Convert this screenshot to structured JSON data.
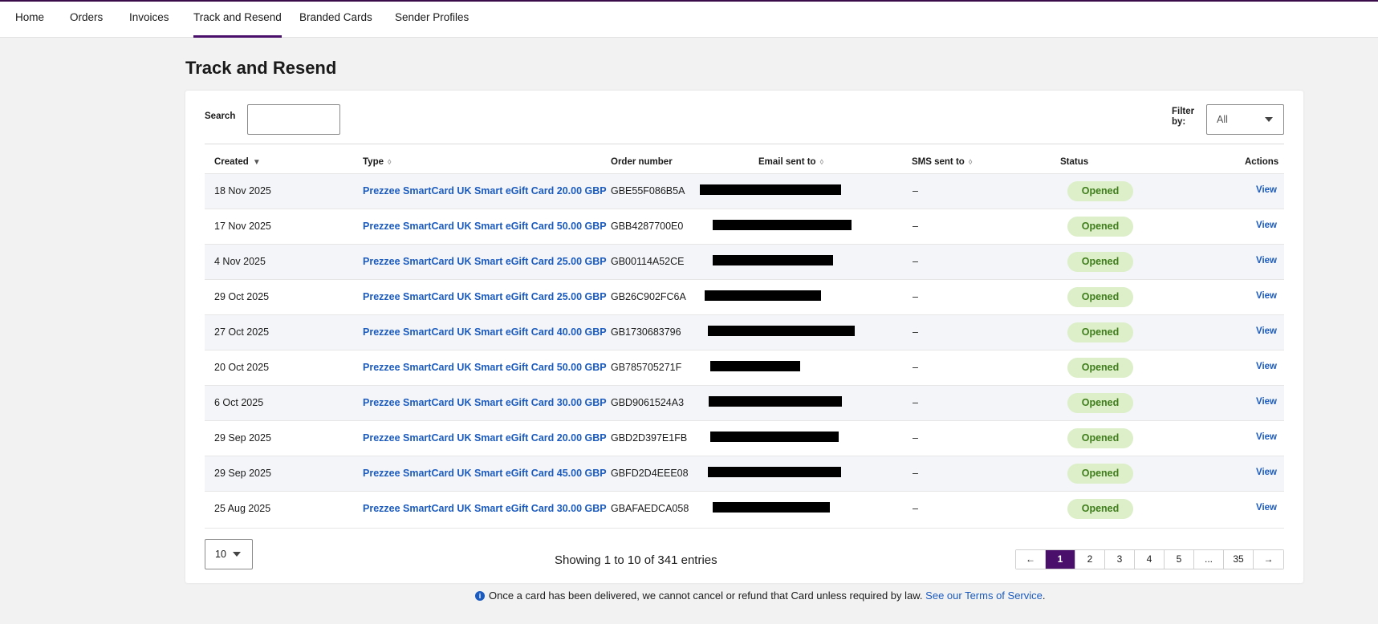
{
  "nav": {
    "items": [
      {
        "label": "Home"
      },
      {
        "label": "Orders"
      },
      {
        "label": "Invoices"
      },
      {
        "label": "Track and Resend"
      },
      {
        "label": "Branded Cards"
      },
      {
        "label": "Sender Profiles"
      }
    ],
    "active": "Track and Resend"
  },
  "page": {
    "title": "Track and Resend"
  },
  "search": {
    "label": "Search",
    "value": ""
  },
  "filter": {
    "label": "Filter by:",
    "value": "All"
  },
  "table": {
    "columns": [
      "Created",
      "Type",
      "Order number",
      "Email sent to",
      "SMS sent to",
      "Status",
      "Actions"
    ],
    "rows": [
      {
        "created": "18 Nov 2025",
        "type": "Prezzee SmartCard UK Smart eGift Card 20.00 GBP",
        "order": "GBE55F086B5A",
        "sms": "–",
        "status": "Opened",
        "action": "View"
      },
      {
        "created": "17 Nov 2025",
        "type": "Prezzee SmartCard UK Smart eGift Card 50.00 GBP",
        "order": "GBB4287700E0",
        "sms": "–",
        "status": "Opened",
        "action": "View"
      },
      {
        "created": "4 Nov 2025",
        "type": "Prezzee SmartCard UK Smart eGift Card 25.00 GBP",
        "order": "GB00114A52CE",
        "sms": "–",
        "status": "Opened",
        "action": "View"
      },
      {
        "created": "29 Oct 2025",
        "type": "Prezzee SmartCard UK Smart eGift Card 25.00 GBP",
        "order": "GB26C902FC6A",
        "sms": "–",
        "status": "Opened",
        "action": "View"
      },
      {
        "created": "27 Oct 2025",
        "type": "Prezzee SmartCard UK Smart eGift Card 40.00 GBP",
        "order": "GB1730683796",
        "sms": "–",
        "status": "Opened",
        "action": "View"
      },
      {
        "created": "20 Oct 2025",
        "type": "Prezzee SmartCard UK Smart eGift Card 50.00 GBP",
        "order": "GB785705271F",
        "sms": "–",
        "status": "Opened",
        "action": "View"
      },
      {
        "created": "6 Oct 2025",
        "type": "Prezzee SmartCard UK Smart eGift Card 30.00 GBP",
        "order": "GBD9061524A3",
        "sms": "–",
        "status": "Opened",
        "action": "View"
      },
      {
        "created": "29 Sep 2025",
        "type": "Prezzee SmartCard UK Smart eGift Card 20.00 GBP",
        "order": "GBD2D397E1FB",
        "sms": "–",
        "status": "Opened",
        "action": "View"
      },
      {
        "created": "29 Sep 2025",
        "type": "Prezzee SmartCard UK Smart eGift Card 45.00 GBP",
        "order": "GBFD2D4EEE08",
        "sms": "–",
        "status": "Opened",
        "action": "View"
      },
      {
        "created": "25 Aug 2025",
        "type": "Prezzee SmartCard UK Smart eGift Card 30.00 GBP",
        "order": "GBAFAEDCA058",
        "sms": "–",
        "status": "Opened",
        "action": "View"
      }
    ]
  },
  "footer": {
    "page_size": "10",
    "showing": "Showing 1 to 10 of 341 entries",
    "pagination": [
      "←",
      "1",
      "2",
      "3",
      "4",
      "5",
      "...",
      "35",
      "→"
    ],
    "current_page": "1"
  },
  "notice": {
    "text": "Once a card has been delivered, we cannot cancel or refund that Card unless required by law.",
    "link": "See our Terms of Service",
    "end": "."
  },
  "colors": {
    "accent": "#4a0e6b",
    "link": "#1b5bbf",
    "badge_bg": "#dcefc8",
    "badge_text": "#3f7d1c"
  }
}
